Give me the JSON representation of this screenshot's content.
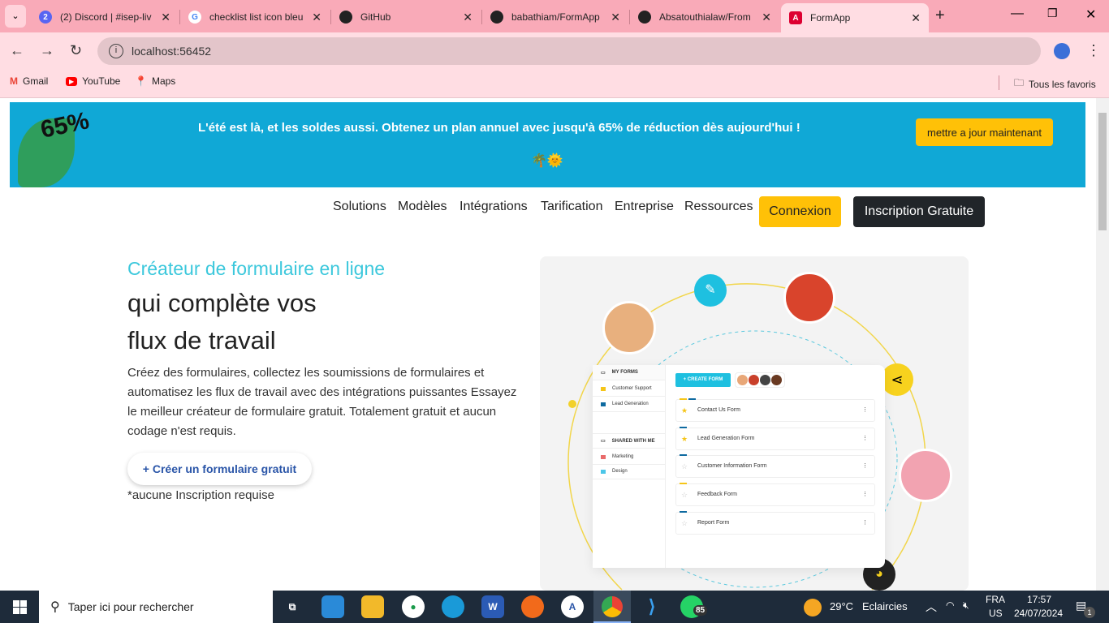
{
  "browser": {
    "tabs": [
      {
        "title": "(2) Discord | #isep-liv",
        "badge": "2"
      },
      {
        "title": "checklist list icon bleu"
      },
      {
        "title": "GitHub"
      },
      {
        "title": "babathiam/FormApp"
      },
      {
        "title": "Absatouthialaw/From"
      },
      {
        "title": "FormApp"
      }
    ],
    "new_tab": "+",
    "url": "localhost:56452",
    "bookmarks": [
      "Gmail",
      "YouTube",
      "Maps"
    ],
    "all_bookmarks": "Tous les favoris"
  },
  "banner": {
    "badge": "65%",
    "text": "L'été est là, et les soldes aussi. Obtenez un plan annuel avec jusqu'à 65% de réduction dès aujourd'hui !",
    "emoji": "🌴🌞",
    "cta": "mettre a jour maintenant"
  },
  "nav": {
    "links": [
      "Solutions",
      "Modèles",
      "Intégrations",
      "Tarification",
      "Entreprise",
      "Ressources"
    ],
    "login": "Connexion",
    "signup": "Inscription Gratuite"
  },
  "hero": {
    "subtitle": "Créateur de formulaire en ligne",
    "title_line1": "qui complète vos",
    "title_line2": "flux de travail",
    "description": "Créez des formulaires, collectez les soumissions de formulaires et automatisez les flux de travail avec des intégrations puissantes Essayez le meilleur créateur de formulaire gratuit. Totalement gratuit et aucun codage n'est requis.",
    "cta": "+ Créer un formulaire gratuit",
    "note": "*aucune Inscription requise"
  },
  "mockup": {
    "my_forms": "MY FORMS",
    "folders": [
      {
        "name": "Customer Support",
        "color": "#f5c518"
      },
      {
        "name": "Lead Generation",
        "color": "#0e6aa0"
      }
    ],
    "shared": "SHARED WITH ME",
    "shared_folders": [
      {
        "name": "Marketing",
        "color": "#e96b6b"
      },
      {
        "name": "Design",
        "color": "#4cc6e8"
      }
    ],
    "create": "+ CREATE FORM",
    "forms": [
      {
        "name": "Contact Us Form",
        "starred": true
      },
      {
        "name": "Lead Generation Form",
        "starred": true
      },
      {
        "name": "Customer Information Form",
        "starred": false
      },
      {
        "name": "Feedback Form",
        "starred": false
      },
      {
        "name": "Report Form",
        "starred": false
      }
    ]
  },
  "taskbar": {
    "search": "Taper ici pour rechercher",
    "whatsapp_badge": "85",
    "weather": "29°C",
    "weather_text": "Eclaircies",
    "lang1": "FRA",
    "lang2": "US",
    "time": "17:57",
    "date": "24/07/2024",
    "notif": "1"
  }
}
